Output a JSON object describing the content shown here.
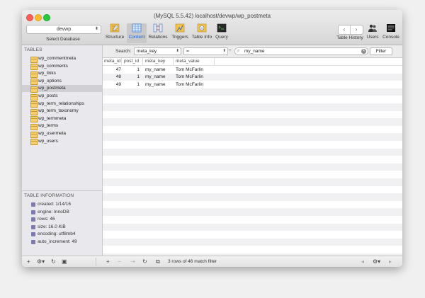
{
  "window": {
    "title": "(MySQL 5.5.42) localhost/devwp/wp_postmeta"
  },
  "toolbar": {
    "database_select": "devwp",
    "database_label": "Select Database",
    "tools": [
      "Structure",
      "Content",
      "Relations",
      "Triggers",
      "Table Info",
      "Query"
    ],
    "right_tools": [
      "Table History",
      "Users",
      "Console"
    ],
    "back_icon": "chevron-left-icon",
    "forward_icon": "chevron-right-icon"
  },
  "sidebar": {
    "tables_header": "TABLES",
    "tables": [
      "wp_commentmeta",
      "wp_comments",
      "wp_links",
      "wp_options",
      "wp_postmeta",
      "wp_posts",
      "wp_term_relationships",
      "wp_term_taxonomy",
      "wp_termmeta",
      "wp_terms",
      "wp_usermeta",
      "wp_users"
    ],
    "selected_table": "wp_postmeta",
    "info_header": "TABLE INFORMATION",
    "info": [
      "created: 1/14/16",
      "engine: InnoDB",
      "rows: 46",
      "size: 16.0 KiB",
      "encoding: utf8mb4",
      "auto_increment: 49"
    ]
  },
  "filter": {
    "search_label": "Search:",
    "field": "meta_key",
    "operator": "=",
    "value": "my_name",
    "button": "Filter"
  },
  "grid": {
    "columns": [
      "meta_id",
      "post_id",
      "meta_key",
      "meta_value"
    ],
    "rows": [
      [
        "47",
        "1",
        "my_name",
        "Tom McFarlin"
      ],
      [
        "48",
        "1",
        "my_name",
        "Tom McFarlin"
      ],
      [
        "49",
        "1",
        "my_name",
        "Tom McFarlin"
      ]
    ]
  },
  "status": {
    "text": "3 rows of 46 match filter"
  },
  "colors": {
    "selected_tab": "#1a63d8",
    "table_icon": "#f5d070"
  }
}
